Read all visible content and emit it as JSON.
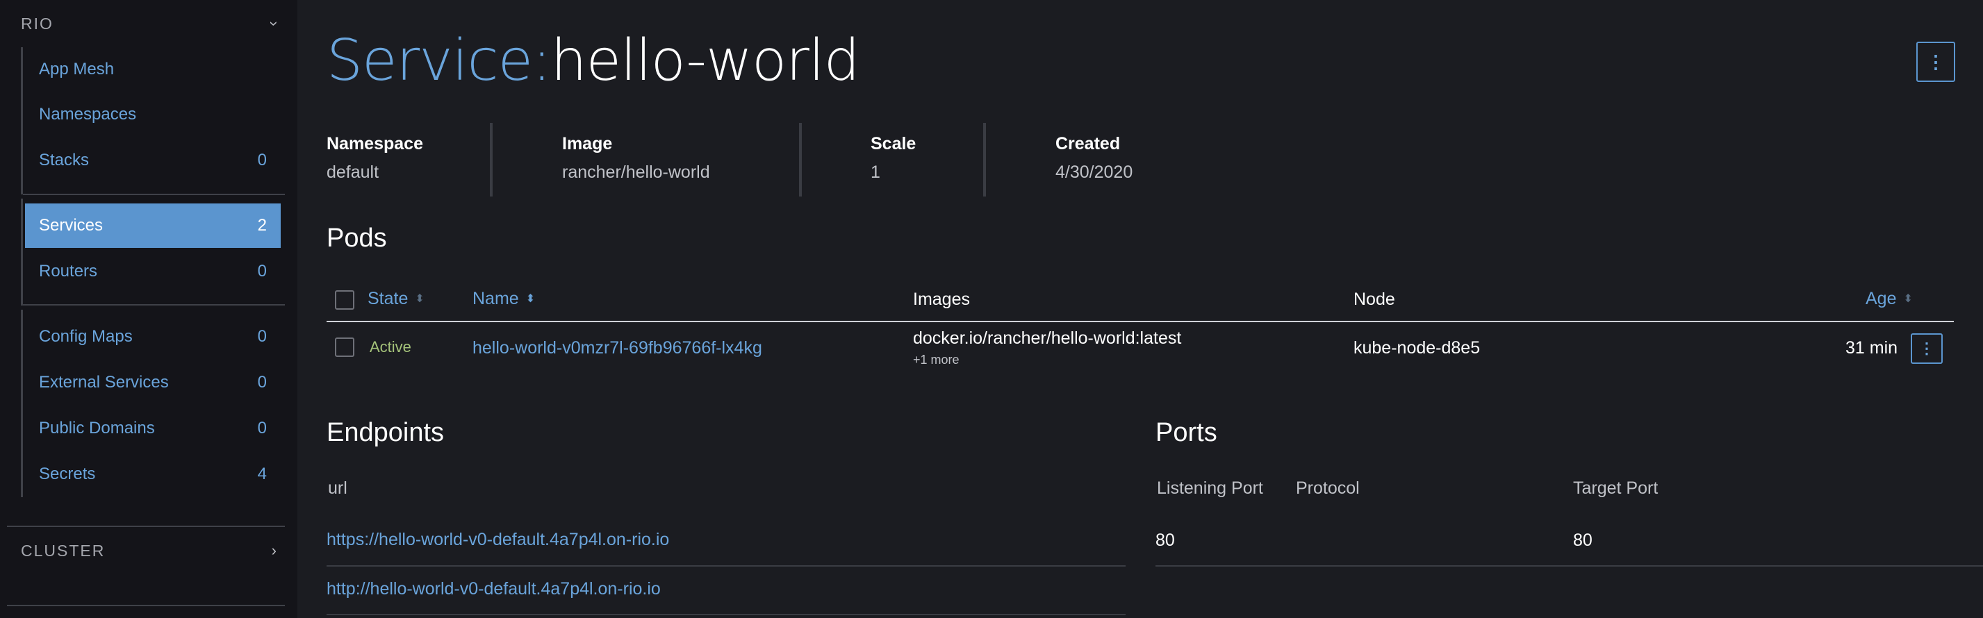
{
  "sidebar": {
    "rio_group": {
      "label": "RIO",
      "chevron_icon": "chevron-down-icon"
    },
    "items": [
      {
        "label": "App Mesh",
        "count": ""
      },
      {
        "label": "Namespaces",
        "count": ""
      },
      {
        "label": "Stacks",
        "count": "0"
      },
      {
        "label": "Services",
        "count": "2",
        "active": true
      },
      {
        "label": "Routers",
        "count": "0"
      },
      {
        "label": "Config Maps",
        "count": "0"
      },
      {
        "label": "External Services",
        "count": "0"
      },
      {
        "label": "Public Domains",
        "count": "0"
      },
      {
        "label": "Secrets",
        "count": "4"
      }
    ],
    "cluster_group": {
      "label": "CLUSTER",
      "chevron_icon": "chevron-right-icon"
    }
  },
  "header": {
    "prefix": "Service:",
    "name": "hello-world",
    "menu_icon": "kebab-menu-icon"
  },
  "details": {
    "namespace": {
      "label": "Namespace",
      "value": "default"
    },
    "image": {
      "label": "Image",
      "value": "rancher/hello-world"
    },
    "scale": {
      "label": "Scale",
      "value": "1"
    },
    "created": {
      "label": "Created",
      "value": "4/30/2020"
    }
  },
  "pods": {
    "title": "Pods",
    "columns": {
      "state": "State",
      "name": "Name",
      "images": "Images",
      "node": "Node",
      "age": "Age"
    },
    "rows": [
      {
        "state": "Active",
        "name": "hello-world-v0mzr7l-69fb96766f-lx4kg",
        "image": "docker.io/rancher/hello-world:latest",
        "more": "+1 more",
        "node": "kube-node-d8e5",
        "age": "31 min"
      }
    ]
  },
  "endpoints": {
    "title": "Endpoints",
    "column": "url",
    "rows": [
      "https://hello-world-v0-default.4a7p4l.on-rio.io",
      "http://hello-world-v0-default.4a7p4l.on-rio.io"
    ]
  },
  "ports": {
    "title": "Ports",
    "columns": {
      "listening": "Listening Port",
      "protocol": "Protocol",
      "target": "Target Port"
    },
    "rows": [
      {
        "listening": "80",
        "protocol": "",
        "target": "80"
      }
    ]
  },
  "colors": {
    "background": "#1b1c21",
    "sidebar": "#141419",
    "accent": "#6aa4db",
    "active_item": "#5b95cf",
    "state_active": "#a5c37a"
  }
}
